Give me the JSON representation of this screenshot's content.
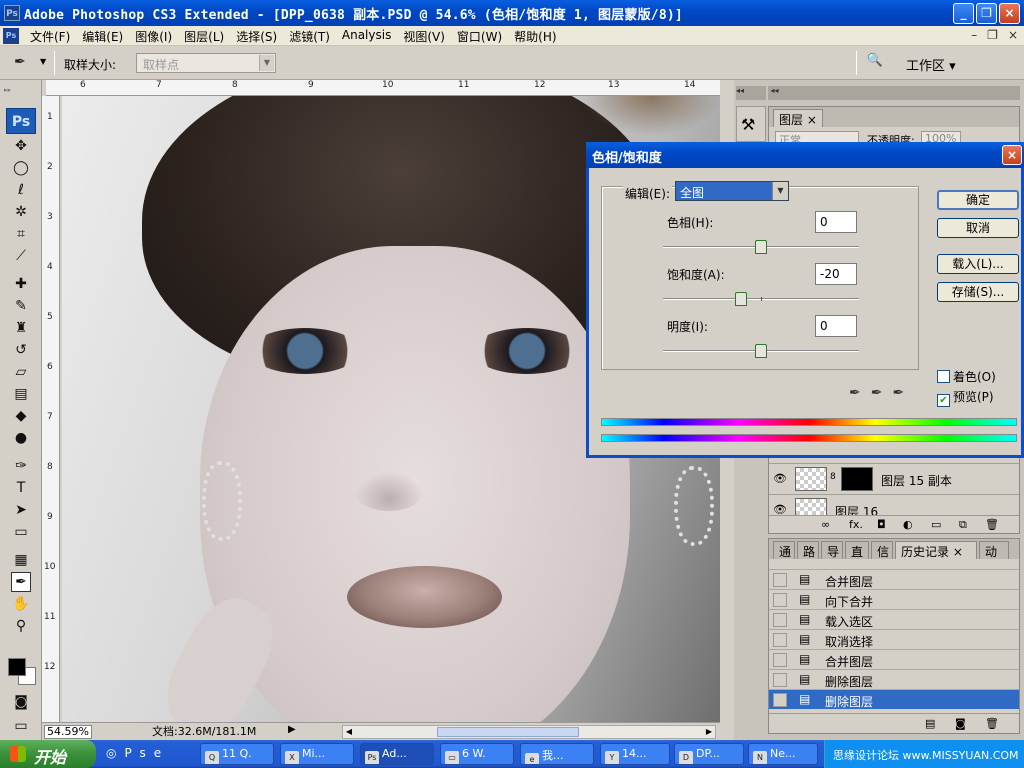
{
  "window": {
    "title": "Adobe Photoshop CS3 Extended - [DPP_0638 副本.PSD @ 54.6% (色相/饱和度 1, 图层蒙版/8)]",
    "buttons": [
      "_",
      "❐",
      "×"
    ]
  },
  "menu": {
    "items": [
      "文件(F)",
      "编辑(E)",
      "图像(I)",
      "图层(L)",
      "选择(S)",
      "滤镜(T)",
      "Analysis",
      "视图(V)",
      "窗口(W)",
      "帮助(H)"
    ],
    "doc_buttons": [
      "–",
      "❐",
      "×"
    ]
  },
  "options": {
    "sample_size_label": "取样大小:",
    "sample_size_value": "取样点",
    "workspace_label": "工作区 ▾"
  },
  "toolbox": {
    "logo": "Ps",
    "tools": [
      "move-icon",
      "marquee-icon",
      "lasso-icon",
      "magic-wand-icon",
      "crop-icon",
      "slice-icon",
      "healing-icon",
      "brush-icon",
      "stamp-icon",
      "history-brush-icon",
      "eraser-icon",
      "gradient-icon",
      "blur-icon",
      "dodge-icon",
      "pen-icon",
      "type-icon",
      "path-select-icon",
      "shape-icon",
      "notes-icon",
      "eyedropper-icon",
      "hand-icon",
      "zoom-icon"
    ]
  },
  "rulers": {
    "top_ticks": [
      "6",
      "7",
      "8",
      "9",
      "10",
      "11",
      "12",
      "13",
      "14"
    ],
    "left_ticks": [
      "1",
      "2",
      "3",
      "4",
      "5",
      "6",
      "7",
      "8",
      "9",
      "10",
      "11",
      "12"
    ]
  },
  "status": {
    "zoom": "54.59%",
    "doc_size": "文档:32.6M/181.1M"
  },
  "layers_panel": {
    "tab": "图层",
    "blend_mode": "正常",
    "opacity_label": "不透明度:",
    "opacity_value": "100%",
    "rows": [
      {
        "name": "图层 15 副本"
      },
      {
        "name": "图层 16"
      }
    ]
  },
  "history_panel": {
    "tabs": [
      "通道",
      "路径",
      "导航器",
      "直方图",
      "信息",
      "历史记录",
      "动作"
    ],
    "active_tab": "历史记录",
    "items": [
      "合并图层",
      "向下合并",
      "载入选区",
      "取消选择",
      "合并图层",
      "删除图层",
      "删除图层"
    ],
    "selected_index": 6
  },
  "dialog": {
    "title": "色相/饱和度",
    "edit_label": "编辑(E):",
    "edit_value": "全图",
    "hue_label": "色相(H):",
    "hue_value": "0",
    "saturation_label": "饱和度(A):",
    "saturation_value": "-20",
    "lightness_label": "明度(I):",
    "lightness_value": "0",
    "ok": "确定",
    "cancel": "取消",
    "load": "载入(L)...",
    "save": "存储(S)...",
    "colorize_label": "着色(O)",
    "colorize_checked": false,
    "preview_label": "预览(P)",
    "preview_checked": true
  },
  "taskbar": {
    "start": "开始",
    "tasks": [
      "11 Q.",
      "Mi...",
      "Ad...",
      "6 W.",
      "我...",
      "14...",
      "DP...",
      "Ne..."
    ],
    "tray_text": "思缘设计论坛 www.MISSYUAN.COM"
  }
}
